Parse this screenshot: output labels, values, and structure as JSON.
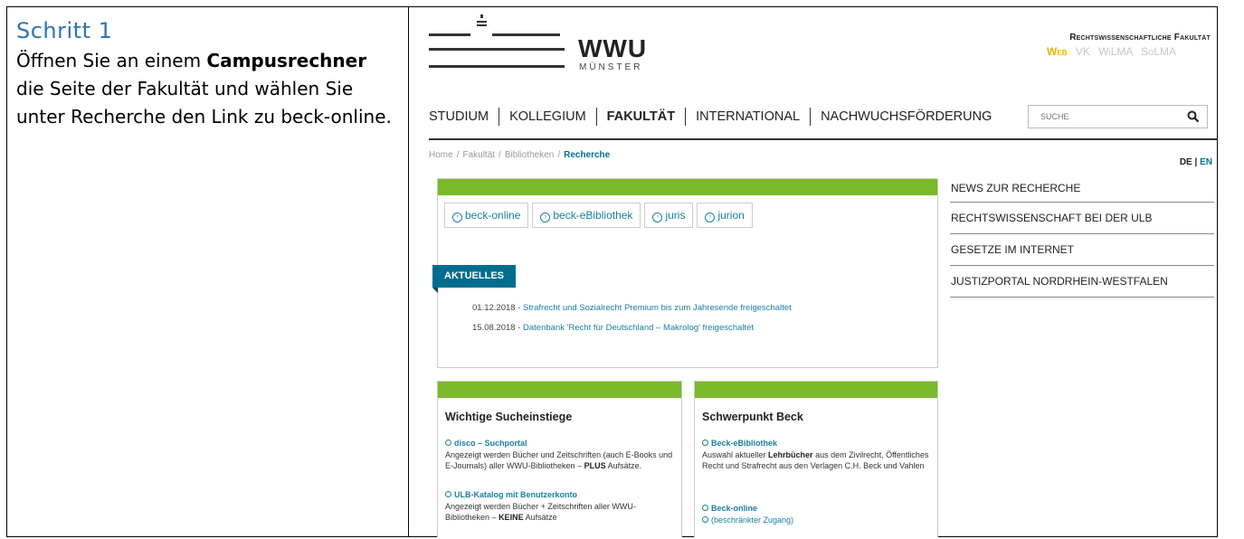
{
  "instructions": {
    "title": "Schritt 1",
    "text_before": "Öffnen Sie an einem ",
    "text_bold": "Campusrechner",
    "text_after": " die Seite der Fakultät und wählen Sie unter Recherche den Link zu beck-online."
  },
  "header": {
    "logo_text": "WWU",
    "logo_subtext": "MÜNSTER",
    "faculty": "Rechtswissenschaftliche Fakultät",
    "faculty_links": [
      "Web",
      "VK",
      "WiLMA",
      "SoLMA"
    ]
  },
  "nav": {
    "items": [
      "STUDIUM",
      "KOLLEGIUM",
      "FAKULTÄT",
      "INTERNATIONAL",
      "NACHWUCHSFÖRDERUNG"
    ],
    "active": "FAKULTÄT"
  },
  "search": {
    "placeholder": "SUCHE",
    "icon": "search-icon"
  },
  "breadcrumb": [
    "Home",
    "Fakultät",
    "Bibliotheken",
    "Recherche"
  ],
  "lang": {
    "de": "DE",
    "en": "EN"
  },
  "tabs": [
    "beck-online",
    "beck-eBibliothek",
    "juris",
    "jurion"
  ],
  "aktuelles": {
    "label": "AKTUELLES",
    "news": [
      {
        "date": "01.12.2018 - ",
        "text": "Strafrecht und Sozialrecht Premium bis zum Jahresende freigeschaltet"
      },
      {
        "date": "15.08.2018 - ",
        "text": "Datenbank 'Recht für Deutschland – Makrolog' freigeschaltet"
      }
    ]
  },
  "box_suche": {
    "title": "Wichtige Sucheinstiege",
    "disco_link": "disco – Suchportal",
    "disco_desc": "Angezeigt werden Bücher und Zeitschriften (auch E-Books und E-Journals) aller WWU-Bibliotheken –",
    "disco_plus": "PLUS",
    "disco_end": " Aufsätze.",
    "ulb_link": "ULB-Katalog mit Benutzerkonto",
    "ulb_desc": "Angezeigt werden Bücher + Zeitschriften aller WWU-Bibliotheken –",
    "ulb_keine": "KEINE",
    "ulb_end": " Aufsätze"
  },
  "box_beck": {
    "title": "Schwerpunkt Beck",
    "ebib_link": "Beck-eBibliothek",
    "ebib_pre": "Auswahl aktueller ",
    "ebib_bold": "Lehrbücher",
    "ebib_post": " aus dem Zivilrecht, Öffentliches Recht und Strafrecht aus den Verlagen C.H. Beck und Vahlen",
    "online_link": "Beck-online",
    "online_sub": "(beschränkter Zugang)"
  },
  "sidebar": [
    "NEWS ZUR RECHERCHE",
    "RECHTSWISSENSCHAFT BEI DER ULB",
    "GESETZE IM INTERNET",
    "JUSTIZPORTAL NORDRHEIN-WESTFALEN"
  ],
  "colors": {
    "green": "#7ab929",
    "teal": "#006d8f",
    "link": "#1a7fa0",
    "step_title": "#2e74b5",
    "gold": "#e8b40a"
  }
}
